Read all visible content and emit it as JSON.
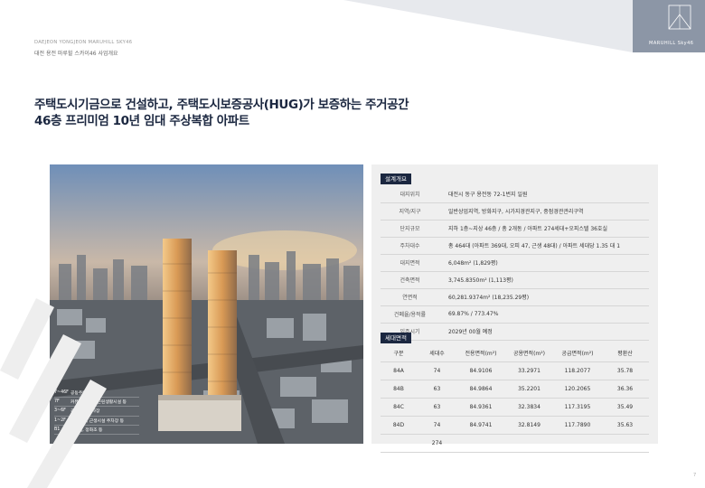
{
  "header": {
    "eyebrow": "DAEJEON YONGJEON MARUHILL SKY46",
    "subtitle": "대전 용전 마루힐 스카이46 사업개요",
    "brand": "MARUHILL Sky46"
  },
  "headline": {
    "line1": "주택도시기금으로 건설하고, 주택도시보증공사(HUG)가 보증하는 주거공간",
    "line2": "46층 프리미엄 10년 임대 주상복합 아파트"
  },
  "floor_legend": [
    {
      "floor": "7~46F",
      "label": "공동주택"
    },
    {
      "floor": "7F",
      "label": "커뮤니티시설, 근린생활시설 등"
    },
    {
      "floor": "3~6F",
      "label": "공동주택 주차장"
    },
    {
      "floor": "1~2F",
      "label": "근생시설, 근생시설 주차장 등"
    },
    {
      "floor": "B1",
      "label": "기전실, 정화조 등"
    }
  ],
  "overview": {
    "title": "설계개요",
    "rows": [
      {
        "key": "대지위치",
        "value": "대전시 동구 용전동 72-1번지 일원"
      },
      {
        "key": "지역/지구",
        "value": "일반상업지역, 방화지구, 시가지경관지구, 중점경관관리구역"
      },
      {
        "key": "단지규모",
        "value": "지하 1층~지상 46층 / 총 2개동 / 아파트 274세대+오피스텔 36호실"
      },
      {
        "key": "주차대수",
        "value": "총 464대 (아파트 369대, 오피 47, 근생 48대) / 아파트 세대당 1.35 대 1"
      },
      {
        "key": "대지면적",
        "value": "6,048m² (1,829평)"
      },
      {
        "key": "건축면적",
        "value": "3,745.8350m² (1,113평)"
      },
      {
        "key": "연면적",
        "value": "60,281.9374m² (18,235.29평)"
      },
      {
        "key": "건폐율/용적률",
        "value": "69.87% / 773.47%"
      },
      {
        "key": "입주시기",
        "value": "2029년 00월 예정"
      }
    ]
  },
  "units": {
    "title": "세대면적",
    "headers": [
      "구분",
      "세대수",
      "전용면적(m²)",
      "공용면적(m²)",
      "공급면적(m²)",
      "평환산"
    ],
    "rows": [
      [
        "84A",
        "74",
        "84.9106",
        "33.2971",
        "118.2077",
        "35.78"
      ],
      [
        "84B",
        "63",
        "84.9864",
        "35.2201",
        "120.2065",
        "36.36"
      ],
      [
        "84C",
        "63",
        "84.9361",
        "32.3834",
        "117.3195",
        "35.49"
      ],
      [
        "84D",
        "74",
        "84.9741",
        "32.8149",
        "117.7890",
        "35.63"
      ]
    ],
    "total": "274"
  },
  "page_number": "7",
  "colors": {
    "navy": "#1b2740",
    "panel": "#efefef",
    "band": "#dde1e7"
  }
}
